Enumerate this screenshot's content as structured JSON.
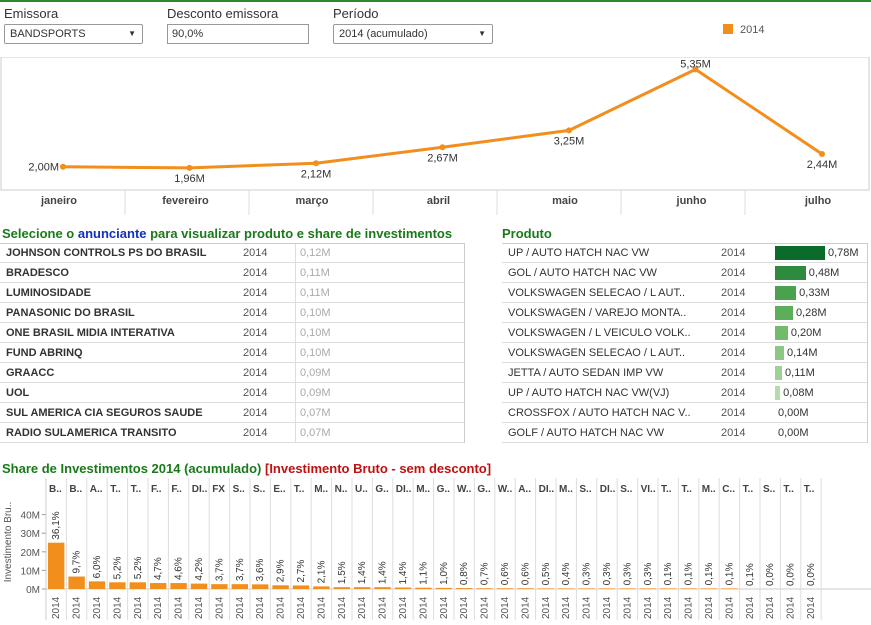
{
  "filters": {
    "emissora_label": "Emissora",
    "emissora_value": "BANDSPORTS",
    "desconto_label": "Desconto emissora",
    "desconto_value": "90,0%",
    "periodo_label": "Período",
    "periodo_value": "2014 (acumulado)"
  },
  "legend": {
    "label": "2014",
    "color": "#f28e1c"
  },
  "line_chart": {
    "type": "line",
    "categories": [
      "janeiro",
      "fevereiro",
      "março",
      "abril",
      "maio",
      "junho",
      "julho"
    ],
    "values": [
      2.0,
      1.96,
      2.12,
      2.67,
      3.25,
      5.35,
      2.44
    ],
    "labels": [
      "2,00M",
      "1,96M",
      "2,12M",
      "2,67M",
      "3,25M",
      "5,35M",
      "2,44M"
    ],
    "series_name": "2014",
    "ylim": [
      1.2,
      5.5
    ],
    "color": "#f28e1c"
  },
  "advertisers": {
    "title_pre": "Selecione o ",
    "title_link": "anunciante",
    "title_post": " para visualizar produto e share de investimentos",
    "rows": [
      {
        "name": "JOHNSON CONTROLS PS DO BRASIL",
        "year": "2014",
        "value": "0,12M"
      },
      {
        "name": "BRADESCO",
        "year": "2014",
        "value": "0,11M"
      },
      {
        "name": "LUMINOSIDADE",
        "year": "2014",
        "value": "0,11M"
      },
      {
        "name": "PANASONIC DO BRASIL",
        "year": "2014",
        "value": "0,10M"
      },
      {
        "name": "ONE BRASIL MIDIA INTERATIVA",
        "year": "2014",
        "value": "0,10M"
      },
      {
        "name": "FUND ABRINQ",
        "year": "2014",
        "value": "0,10M"
      },
      {
        "name": "GRAACC",
        "year": "2014",
        "value": "0,09M"
      },
      {
        "name": "UOL",
        "year": "2014",
        "value": "0,09M"
      },
      {
        "name": "SUL AMERICA CIA SEGUROS SAUDE",
        "year": "2014",
        "value": "0,07M"
      },
      {
        "name": "RADIO SULAMERICA TRANSITO",
        "year": "2014",
        "value": "0,07M"
      }
    ]
  },
  "products": {
    "title": "Produto",
    "max": 0.78,
    "rows": [
      {
        "name": "UP / AUTO HATCH NAC VW",
        "year": "2014",
        "value": 0.78,
        "label": "0,78M",
        "color": "#0b6b2a"
      },
      {
        "name": "GOL / AUTO HATCH NAC VW",
        "year": "2014",
        "value": 0.48,
        "label": "0,48M",
        "color": "#2e8b3e"
      },
      {
        "name": "VOLKSWAGEN SELECAO / L AUT..",
        "year": "2014",
        "value": 0.33,
        "label": "0,33M",
        "color": "#4aa14e"
      },
      {
        "name": "VOLKSWAGEN / VAREJO MONTA..",
        "year": "2014",
        "value": 0.28,
        "label": "0,28M",
        "color": "#5cae5a"
      },
      {
        "name": "VOLKSWAGEN / L VEICULO VOLK..",
        "year": "2014",
        "value": 0.2,
        "label": "0,20M",
        "color": "#73bb6c"
      },
      {
        "name": "VOLKSWAGEN SELECAO / L AUT..",
        "year": "2014",
        "value": 0.14,
        "label": "0,14M",
        "color": "#8cc784"
      },
      {
        "name": "JETTA / AUTO SEDAN IMP VW",
        "year": "2014",
        "value": 0.11,
        "label": "0,11M",
        "color": "#9ed196"
      },
      {
        "name": "UP / AUTO HATCH NAC VW(VJ)",
        "year": "2014",
        "value": 0.08,
        "label": "0,08M",
        "color": "#b2dcaa"
      },
      {
        "name": "CROSSFOX / AUTO HATCH NAC V..",
        "year": "2014",
        "value": 0.0,
        "label": "0,00M",
        "color": "#c8e6c0"
      },
      {
        "name": "GOLF / AUTO HATCH NAC VW",
        "year": "2014",
        "value": 0.0,
        "label": "0,00M",
        "color": "#c8e6c0"
      }
    ]
  },
  "share": {
    "title_main": "Share de Investimentos 2014 (acumulado) ",
    "title_red": "[Investimento Bruto - sem desconto]",
    "ylabel": "Investimento Bru..",
    "yticks": [
      "40M",
      "30M",
      "20M",
      "10M",
      "0M"
    ],
    "ylim": [
      0,
      50
    ],
    "year": "2014",
    "color": "#f28e1c",
    "chart_data": {
      "type": "bar",
      "categories": [
        "B..",
        "B..",
        "A..",
        "T..",
        "T..",
        "F..",
        "F..",
        "DI..",
        "FX",
        "S..",
        "S..",
        "E..",
        "T..",
        "M..",
        "N..",
        "U..",
        "G..",
        "DI..",
        "M..",
        "G..",
        "W..",
        "G..",
        "W..",
        "A..",
        "DI..",
        "M..",
        "S..",
        "DI..",
        "S..",
        "VI..",
        "T..",
        "T..",
        "M..",
        "C..",
        "T..",
        "S..",
        "T..",
        "T.."
      ],
      "values": [
        24.9,
        6.7,
        4.1,
        3.6,
        3.6,
        3.2,
        3.2,
        2.9,
        2.6,
        2.6,
        2.5,
        2.0,
        1.9,
        1.4,
        1.0,
        1.0,
        1.0,
        0.8,
        0.7,
        0.6,
        0.5,
        0.4,
        0.4,
        0.4,
        0.3,
        0.3,
        0.2,
        0.2,
        0.2,
        0.1,
        0.1,
        0.1,
        0.1,
        0.1,
        0.0,
        0.0,
        0.0,
        0.0
      ],
      "labels": [
        "36,1%",
        "9,7%",
        "6,0%",
        "5,2%",
        "5,2%",
        "4,7%",
        "4,6%",
        "4,2%",
        "3,7%",
        "3,7%",
        "3,6%",
        "2,9%",
        "2,7%",
        "2,1%",
        "1,5%",
        "1,4%",
        "1,4%",
        "1,4%",
        "1,1%",
        "1,0%",
        "0,8%",
        "0,7%",
        "0,6%",
        "0,6%",
        "0,5%",
        "0,4%",
        "0,3%",
        "0,3%",
        "0,3%",
        "0,3%",
        "0,1%",
        "0,1%",
        "0,1%",
        "0,1%",
        "0,1%",
        "0,0%",
        "0,0%",
        "0,0%"
      ]
    }
  }
}
